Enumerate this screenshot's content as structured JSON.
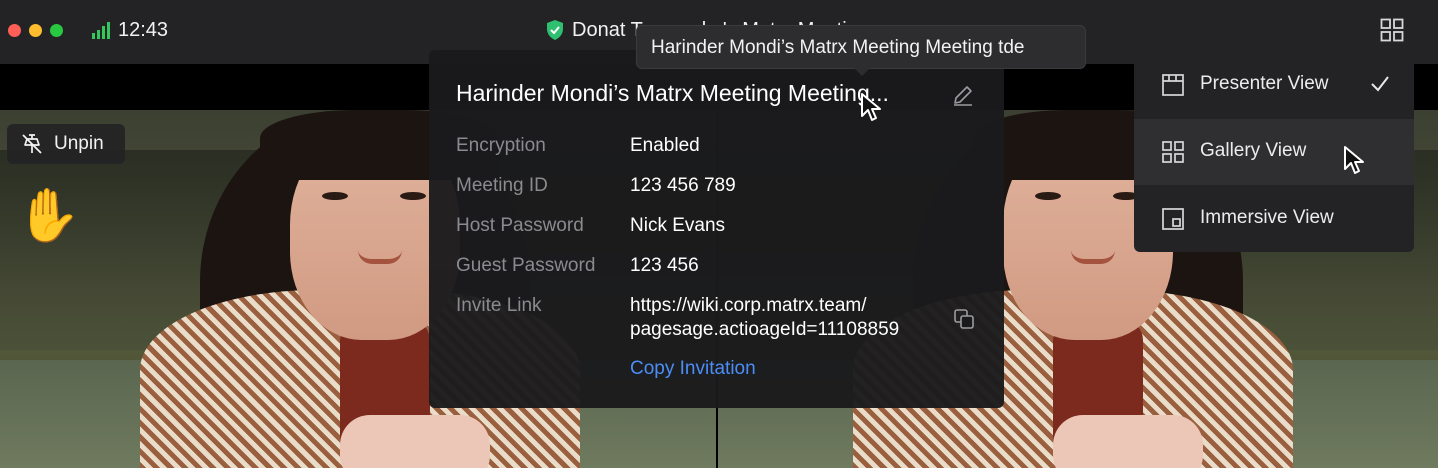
{
  "window": {
    "clock": "12:43",
    "title": "Donat Tarasenko's Matrx Meeting"
  },
  "video": {
    "unpin_label": "Unpin",
    "raise_hand": "✋"
  },
  "info_panel": {
    "title": "Harinder Mondi’s Matrx Meeting Meeting...",
    "rows": [
      {
        "label": "Encryption",
        "value": "Enabled"
      },
      {
        "label": "Meeting ID",
        "value": "123 456 789"
      },
      {
        "label": "Host Password",
        "value": "Nick Evans"
      },
      {
        "label": "Guest Password",
        "value": "123 456"
      },
      {
        "label": "Invite Link",
        "value_line1": "https://wiki.corp.matrx.team/",
        "value_line2": "pagesage.actioageId=11108859"
      }
    ],
    "copy_invitation": "Copy Invitation"
  },
  "tooltip": {
    "text": "Harinder Mondi’s Matrx Meeting Meeting tde"
  },
  "view_menu": {
    "items": [
      {
        "label": "Presenter View",
        "icon": "presenter-view-icon",
        "selected": true
      },
      {
        "label": "Gallery View",
        "icon": "gallery-view-icon",
        "selected": false
      },
      {
        "label": "Immersive View",
        "icon": "immersive-view-icon",
        "selected": false
      }
    ]
  },
  "colors": {
    "titlebar": "#232325",
    "accent_link": "#4c8df6",
    "label_gray": "#8b8b8f",
    "secure_green": "#2fbf71"
  }
}
